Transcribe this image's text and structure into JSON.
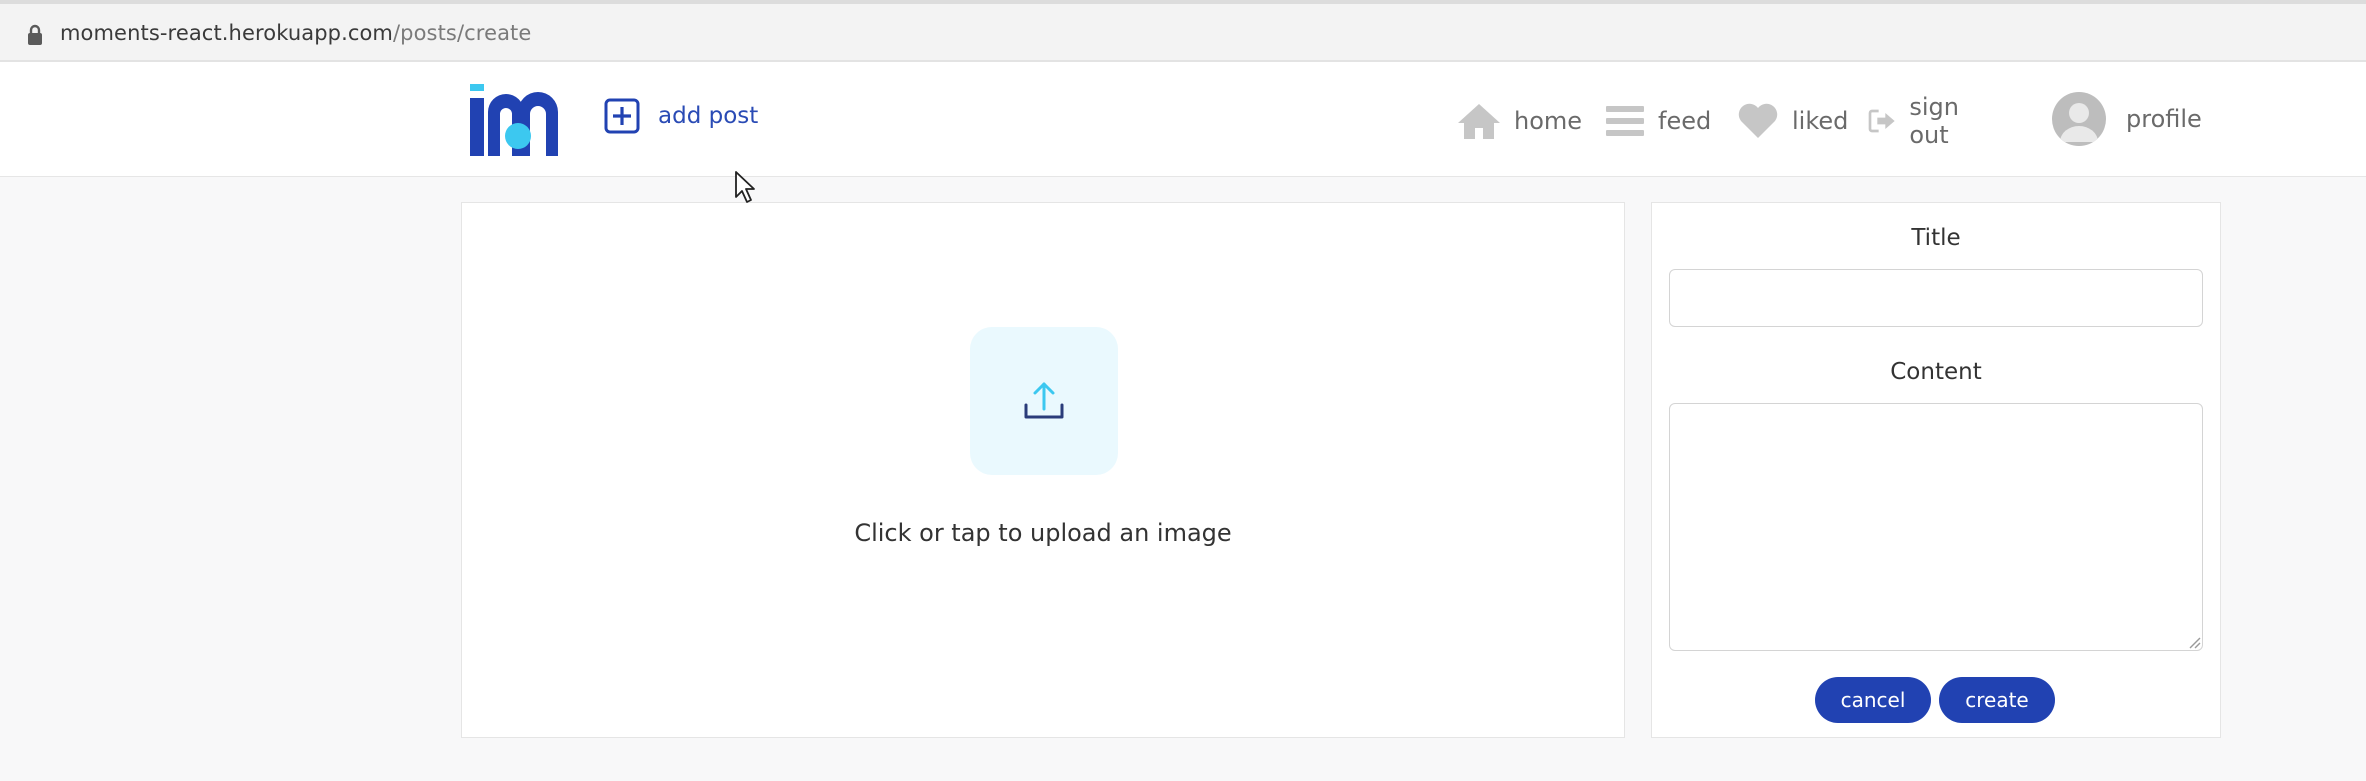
{
  "address_bar": {
    "url_host": "moments-react.herokuapp.com",
    "url_path": "/posts/create"
  },
  "navbar": {
    "logo_icon": "moments-logo-icon",
    "add_post_label": "add post",
    "items": [
      {
        "label": "home",
        "icon": "home-icon"
      },
      {
        "label": "feed",
        "icon": "feed-icon"
      },
      {
        "label": "liked",
        "icon": "heart-icon"
      },
      {
        "label": "sign out",
        "icon": "sign-out-icon"
      },
      {
        "label": "profile",
        "icon": "avatar"
      }
    ]
  },
  "upload": {
    "icon": "upload-icon",
    "text": "Click or tap to upload an image"
  },
  "form": {
    "title_label": "Title",
    "title_value": "",
    "content_label": "Content",
    "content_value": "",
    "cancel_label": "cancel",
    "create_label": "create"
  },
  "colors": {
    "brand_blue": "#2142b2",
    "accent_cyan": "#3cc8f0",
    "upload_bg": "#eaf9fe"
  }
}
